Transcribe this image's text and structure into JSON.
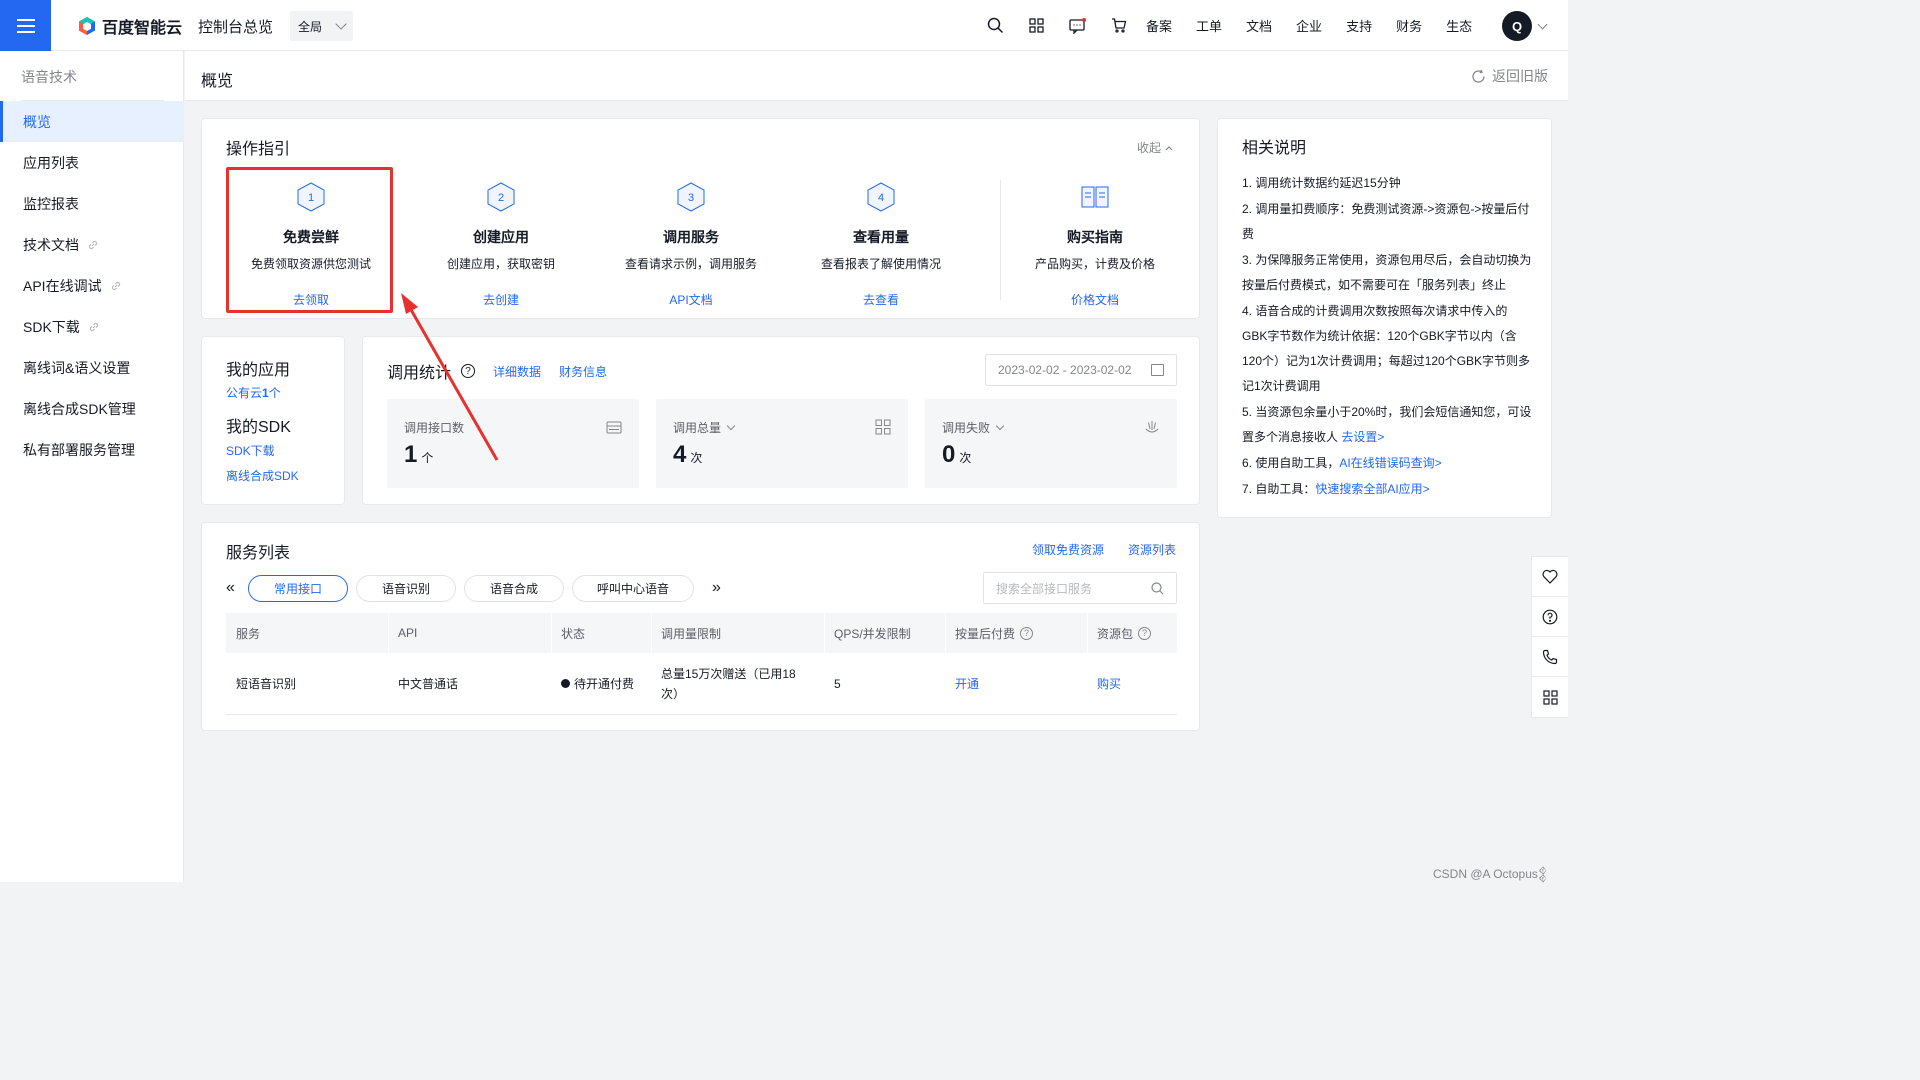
{
  "topbar": {
    "logo_text": "百度智能云",
    "nav_title": "控制台总览",
    "scope": "全局",
    "links": [
      "备案",
      "工单",
      "文档",
      "企业",
      "支持",
      "财务",
      "生态"
    ],
    "avatar_letter": "Q",
    "icons": [
      "search-icon",
      "apps-icon",
      "message-icon",
      "cart-icon"
    ]
  },
  "sidebar": {
    "title": "语音技术",
    "items": [
      {
        "label": "概览",
        "active": true,
        "external": false
      },
      {
        "label": "应用列表",
        "active": false,
        "external": false
      },
      {
        "label": "监控报表",
        "active": false,
        "external": false
      },
      {
        "label": "技术文档",
        "active": false,
        "external": true
      },
      {
        "label": "API在线调试",
        "active": false,
        "external": true
      },
      {
        "label": "SDK下载",
        "active": false,
        "external": true
      },
      {
        "label": "离线词&语义设置",
        "active": false,
        "external": false
      },
      {
        "label": "离线合成SDK管理",
        "active": false,
        "external": false
      },
      {
        "label": "私有部署服务管理",
        "active": false,
        "external": false
      }
    ]
  },
  "header": {
    "title": "概览",
    "back_old": "返回旧版"
  },
  "guide": {
    "title": "操作指引",
    "collapse": "收起",
    "steps": [
      {
        "num": "1",
        "name": "免费尝鲜",
        "desc": "免费领取资源供您测试",
        "link": "去领取"
      },
      {
        "num": "2",
        "name": "创建应用",
        "desc": "创建应用，获取密钥",
        "link": "去创建"
      },
      {
        "num": "3",
        "name": "调用服务",
        "desc": "查看请求示例，调用服务",
        "link": "API文档"
      },
      {
        "num": "4",
        "name": "查看用量",
        "desc": "查看报表了解使用情况",
        "link": "去查看"
      },
      {
        "num": "",
        "name": "购买指南",
        "desc": "产品购买，计费及价格",
        "link": "价格文档"
      }
    ]
  },
  "myapp": {
    "app_title": "我的应用",
    "app_link_prefix": "公有云",
    "app_count": "1",
    "app_link_suffix": "个",
    "sdk_title": "我的SDK",
    "sdk_link1": "SDK下载",
    "sdk_link2": "离线合成SDK"
  },
  "stats": {
    "title": "调用统计",
    "help": "?",
    "link_detail": "详细数据",
    "link_finance": "财务信息",
    "date_range": "2023-02-02 - 2023-02-02",
    "tiles": [
      {
        "label": "调用接口数",
        "value": "1",
        "unit": "个",
        "dropdown": false
      },
      {
        "label": "调用总量",
        "value": "4",
        "unit": "次",
        "dropdown": true
      },
      {
        "label": "调用失败",
        "value": "0",
        "unit": "次",
        "dropdown": true
      }
    ]
  },
  "related": {
    "title": "相关说明",
    "items": [
      {
        "text": "1. 调用统计数据约延迟15分钟",
        "link": ""
      },
      {
        "text": "2. 调用量扣费顺序：免费测试资源->资源包->按量后付费",
        "link": ""
      },
      {
        "text": "3. 为保障服务正常使用，资源包用尽后，会自动切换为按量后付费模式，如不需要可在「服务列表」终止",
        "link": ""
      },
      {
        "text": "4. 语音合成的计费调用次数按照每次请求中传入的GBK字节数作为统计依据：120个GBK字节以内（含120个）记为1次计费调用；每超过120个GBK字节则多记1次计费调用",
        "link": ""
      },
      {
        "text": "5. 当资源包余量小于20%时，我们会短信通知您，可设置多个消息接收人 ",
        "link": "去设置>"
      },
      {
        "text": "6. 使用自助工具，",
        "link": "AI在线错误码查询>"
      },
      {
        "text": "7. 自助工具：",
        "link": "快速搜索全部AI应用>"
      }
    ]
  },
  "service": {
    "title": "服务列表",
    "link_free": "领取免费资源",
    "link_resources": "资源列表",
    "tabs": [
      "常用接口",
      "语音识别",
      "语音合成",
      "呼叫中心语音"
    ],
    "search_placeholder": "搜索全部接口服务",
    "columns": [
      "服务",
      "API",
      "状态",
      "调用量限制",
      "QPS/并发限制",
      "按量后付费",
      "资源包"
    ],
    "rows": [
      {
        "service": "短语音识别",
        "api": "中文普通话",
        "status": "待开通付费",
        "limit": "总量15万次赠送（已用18次）",
        "qps": "5",
        "postpay": "开通",
        "package": "购买"
      }
    ]
  },
  "watermark": "CSDN @A   Octopus𒉭",
  "colors": {
    "brand": "#2468f2",
    "highlight": "#e8312f"
  }
}
